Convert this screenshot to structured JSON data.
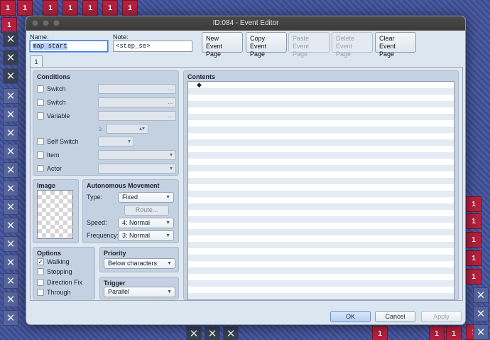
{
  "window": {
    "title": "ID:084 - Event Editor"
  },
  "fields": {
    "name_label": "Name:",
    "name_value": "map start",
    "note_label": "Note:",
    "note_value": "<step_se>"
  },
  "toolbar": {
    "new": [
      "New",
      "Event Page"
    ],
    "copy": [
      "Copy",
      "Event Page"
    ],
    "paste": [
      "Paste",
      "Event Page"
    ],
    "delete": [
      "Delete",
      "Event Page"
    ],
    "clear": [
      "Clear",
      "Event Page"
    ]
  },
  "tab": "1",
  "conditions": {
    "title": "Conditions",
    "switch1": "Switch",
    "switch2": "Switch",
    "variable": "Variable",
    "ellipsis": "...",
    "gte": "≥",
    "self_switch": "Self Switch",
    "item": "Item",
    "actor": "Actor"
  },
  "image": {
    "title": "Image"
  },
  "movement": {
    "title": "Autonomous Movement",
    "type_label": "Type:",
    "type_value": "Fixed",
    "route": "Route...",
    "speed_label": "Speed:",
    "speed_value": "4: Normal",
    "freq_label": "Frequency:",
    "freq_value": "3: Normal"
  },
  "options": {
    "title": "Options",
    "walking": "Walking",
    "walking_checked": true,
    "stepping": "Stepping",
    "direction_fix": "Direction Fix",
    "through": "Through"
  },
  "priority": {
    "title": "Priority",
    "value": "Below characters"
  },
  "trigger": {
    "title": "Trigger",
    "value": "Parallel"
  },
  "contents": {
    "title": "Contents",
    "first_line": "◆"
  },
  "footer": {
    "ok": "OK",
    "cancel": "Cancel",
    "apply": "Apply"
  },
  "background": {
    "tile_digit": "1",
    "tile_x": "✕"
  }
}
